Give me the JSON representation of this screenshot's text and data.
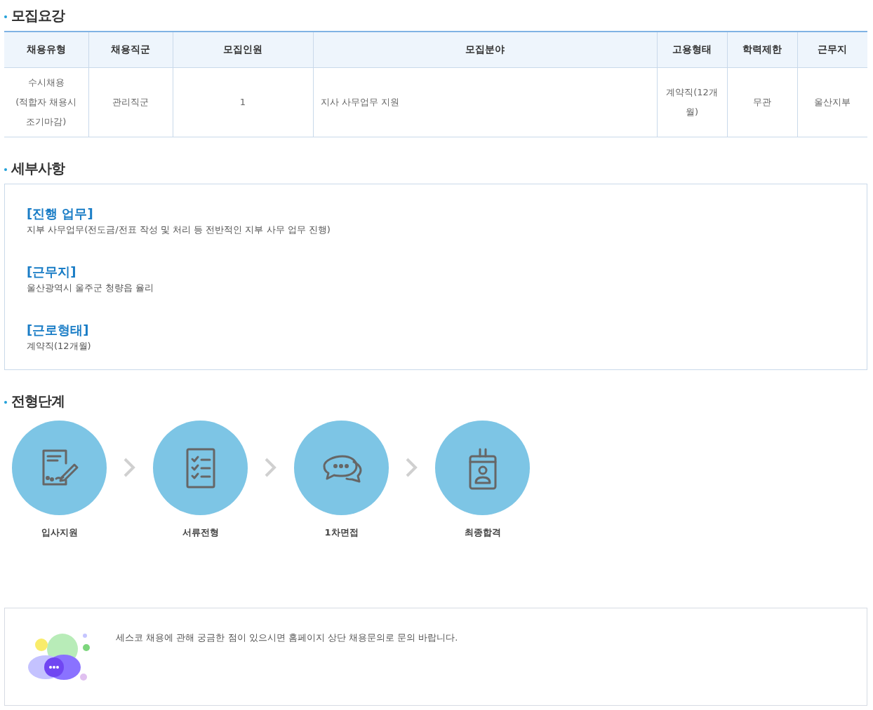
{
  "recruitment": {
    "title": "모집요강",
    "columns": [
      "채용유형",
      "채용직군",
      "모집인원",
      "모집분야",
      "고용형태",
      "학력제한",
      "근무지"
    ],
    "rows": [
      {
        "cells": [
          "수시채용\n(적합자 채용시\n조기마감)",
          "관리직군",
          "1",
          "지사 사무업무 지원",
          "계약직(12개\n월)",
          "무관",
          "울산지부"
        ]
      }
    ]
  },
  "details": {
    "title": "세부사항",
    "items": [
      {
        "heading": "[진행 업무]",
        "text": "지부 사무업무(전도금/전표 작성 및 처리 등 전반적인 지부 사무 업무 진행)"
      },
      {
        "heading": "[근무지]",
        "text": "울산광역시 울주군 청량읍 율리"
      },
      {
        "heading": "[근로형태]",
        "text": "계약직(12개월)"
      }
    ]
  },
  "process": {
    "title": "전형단계",
    "steps": [
      {
        "kind": "application",
        "label": "입사지원"
      },
      {
        "kind": "documents",
        "label": "서류전형"
      },
      {
        "kind": "interview",
        "label": "1차면접"
      },
      {
        "kind": "final",
        "label": "최종합격"
      }
    ]
  },
  "notice": {
    "text": "세스코 채용에 관해 궁금한 점이 있으시면 홈페이지 상단 채용문의로 문의 바랍니다."
  }
}
